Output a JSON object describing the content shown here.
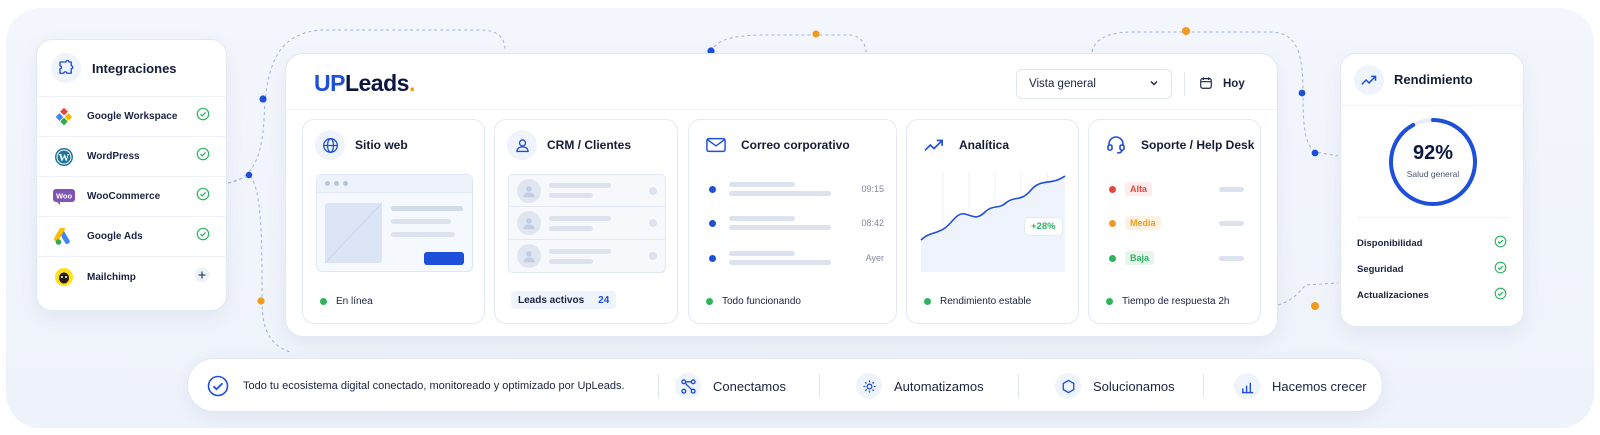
{
  "integrations": {
    "title": "Integraciones",
    "items": [
      {
        "name": "Google Workspace",
        "status": "connected"
      },
      {
        "name": "WordPress",
        "status": "connected"
      },
      {
        "name": "WooCommerce",
        "status": "connected"
      },
      {
        "name": "Google Ads",
        "status": "connected"
      },
      {
        "name": "Mailchimp",
        "status": "add"
      }
    ]
  },
  "header": {
    "logo_up": "UP",
    "logo_leads": "Leads",
    "logo_dot": ".",
    "view_select": "Vista general",
    "date_label": "Hoy"
  },
  "panels": {
    "website": {
      "title": "Sitio web",
      "status": "En línea"
    },
    "crm": {
      "title": "CRM / Clientes",
      "leads_label": "Leads activos",
      "leads_count": "24"
    },
    "email": {
      "title": "Correo corporativo",
      "times": [
        "09:15",
        "08:42",
        "Ayer"
      ],
      "status": "Todo funcionando"
    },
    "analytics": {
      "title": "Analítica",
      "badge": "+28%",
      "status": "Rendimiento estable"
    },
    "support": {
      "title": "Soporte / Help Desk",
      "priorities": [
        "Alta",
        "Media",
        "Baja"
      ],
      "status": "Tiempo de respuesta 2h"
    }
  },
  "performance": {
    "title": "Rendimiento",
    "score": "92%",
    "score_value": 0.92,
    "score_label": "Salud general",
    "checks": [
      "Disponibilidad",
      "Seguridad",
      "Actualizaciones"
    ]
  },
  "bottom": {
    "tagline": "Todo tu ecosistema digital conectado, monitoreado y optimizado por UpLeads.",
    "actions": [
      "Conectamos",
      "Automatizamos",
      "Solucionamos",
      "Hacemos crecer"
    ]
  },
  "colors": {
    "brand_blue": "#1d4fd8",
    "accent_orange": "#f39a1c",
    "success_green": "#2fb360",
    "priority_high": "#e5483a",
    "priority_medium": "#f39a1c",
    "priority_low": "#2fb360"
  }
}
